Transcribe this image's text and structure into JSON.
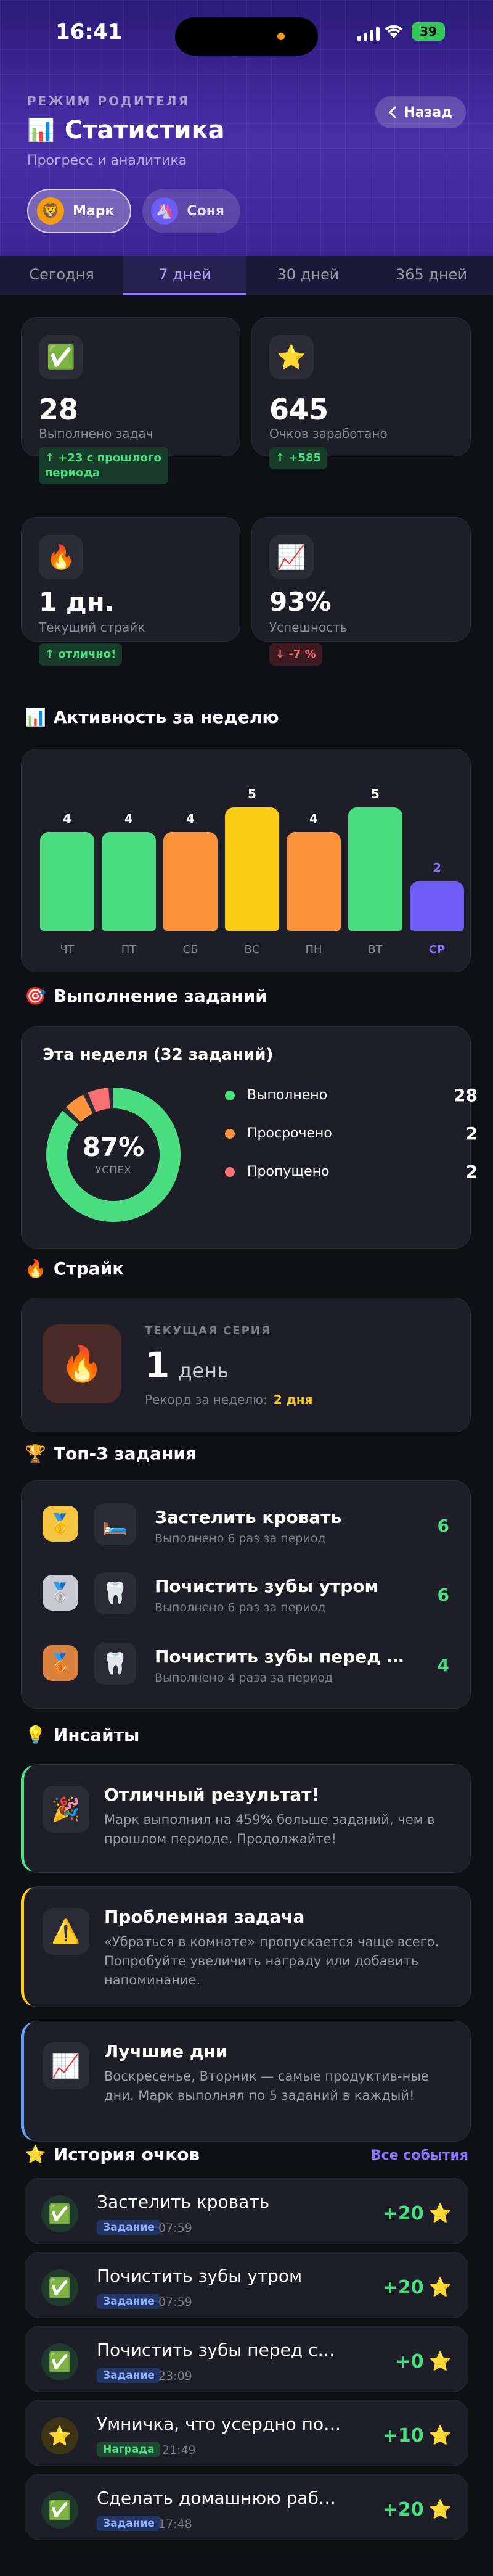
{
  "status": {
    "time": "16:41",
    "battery": "39"
  },
  "header": {
    "mode_label": "РЕЖИМ РОДИТЕЛЯ",
    "title_icon": "📊",
    "title": "Статистика",
    "subtitle": "Прогресс и аналитика",
    "back_label": "Назад",
    "kids": [
      {
        "name": "Марк",
        "avatar": "🦁",
        "active": true
      },
      {
        "name": "Соня",
        "avatar": "🦄",
        "active": false
      }
    ]
  },
  "tabs": [
    "Сегодня",
    "7 дней",
    "30 дней",
    "365 дней"
  ],
  "active_tab": 1,
  "stats": [
    {
      "icon": "✅",
      "value": "28",
      "label": "Выполнено задач",
      "delta": "↑ +23 с прошлого периода",
      "trend": "up"
    },
    {
      "icon": "⭐",
      "value": "645",
      "label": "Очков заработано",
      "delta": "↑ +585",
      "trend": "up"
    },
    {
      "icon": "🔥",
      "value": "1 дн.",
      "label": "Текущий страйк",
      "delta": "↑ отлично!",
      "trend": "up"
    },
    {
      "icon": "📈",
      "value": "93%",
      "label": "Успешность",
      "delta": "↓ -7 %",
      "trend": "down"
    }
  ],
  "activity": {
    "section_icon": "📊",
    "section_title": "Активность за неделю",
    "chart_data": {
      "type": "bar",
      "categories": [
        "ЧТ",
        "ПТ",
        "СБ",
        "ВС",
        "ПН",
        "ВТ",
        "СР"
      ],
      "values": [
        4,
        4,
        4,
        5,
        4,
        5,
        2
      ],
      "colors": [
        "#4ade80",
        "#4ade80",
        "#fb923c",
        "#facc15",
        "#fb923c",
        "#4ade80",
        "#6d5cf6"
      ],
      "ylim": [
        0,
        5
      ]
    }
  },
  "completion": {
    "section_icon": "🎯",
    "section_title": "Выполнение заданий",
    "card_title": "Эта неделя (32 заданий)",
    "percent": "87%",
    "percent_label": "УСПЕХ",
    "chart_data": {
      "type": "pie",
      "labels": [
        "Выполнено",
        "Просрочено",
        "Пропущено"
      ],
      "values": [
        28,
        2,
        2
      ],
      "colors": [
        "#4ade80",
        "#fb923c",
        "#f87171"
      ]
    }
  },
  "streak": {
    "section_icon": "🔥",
    "section_title": "Страйк",
    "icon": "🔥",
    "label": "ТЕКУЩАЯ СЕРИЯ",
    "value": "1",
    "unit": "день",
    "record_label": "Рекорд за неделю:",
    "record_value": "2 дня"
  },
  "top_tasks": {
    "section_icon": "🏆",
    "section_title": "Топ-3 задания",
    "items": [
      {
        "medal": "🥇",
        "icon": "🛏️",
        "name": "Застелить кровать",
        "sub": "Выполнено 6 раз за период",
        "count": "6"
      },
      {
        "medal": "🥈",
        "icon": "🦷",
        "name": "Почистить зубы утром",
        "sub": "Выполнено 6 раз за период",
        "count": "6"
      },
      {
        "medal": "🥉",
        "icon": "🦷",
        "name": "Почистить зубы перед сн…",
        "sub": "Выполнено 4 раза за период",
        "count": "4"
      }
    ]
  },
  "insights": {
    "section_icon": "💡",
    "section_title": "Инсайты",
    "items": [
      {
        "icon": "🎉",
        "title": "Отличный результат!",
        "text": "Марк выполнил на 459% больше заданий, чем в прошлом периоде. Продолжайте!"
      },
      {
        "icon": "⚠️",
        "title": "Проблемная задача",
        "text": "«Убраться в комнате» пропускается чаще всего. Попробуйте увеличить награду или добавить напоминание."
      },
      {
        "icon": "📈",
        "title": "Лучшие дни",
        "text": "Воскресенье, Вторник — самые продуктив-ные дни. Марк выполнял по 5 заданий в каждый!"
      }
    ]
  },
  "history": {
    "section_icon": "⭐",
    "section_title": "История очков",
    "all_label": "Все события",
    "items": [
      {
        "icon": "✅",
        "name": "Застелить кровать",
        "tag": "Задание",
        "kind": "task",
        "time": "07:59",
        "points": "+20"
      },
      {
        "icon": "✅",
        "name": "Почистить зубы утром",
        "tag": "Задание",
        "kind": "task",
        "time": "07:59",
        "points": "+20"
      },
      {
        "icon": "✅",
        "name": "Почистить зубы перед сном",
        "tag": "Задание",
        "kind": "task",
        "time": "23:09",
        "points": "+0"
      },
      {
        "icon": "⭐",
        "name": "Умничка, что усердно поучи…",
        "tag": "Награда",
        "kind": "reward",
        "time": "21:49",
        "points": "+10"
      },
      {
        "icon": "✅",
        "name": "Сделать домашнюю работу",
        "tag": "Задание",
        "kind": "task",
        "time": "17:48",
        "points": "+20"
      }
    ],
    "star_icon": "⭐"
  }
}
